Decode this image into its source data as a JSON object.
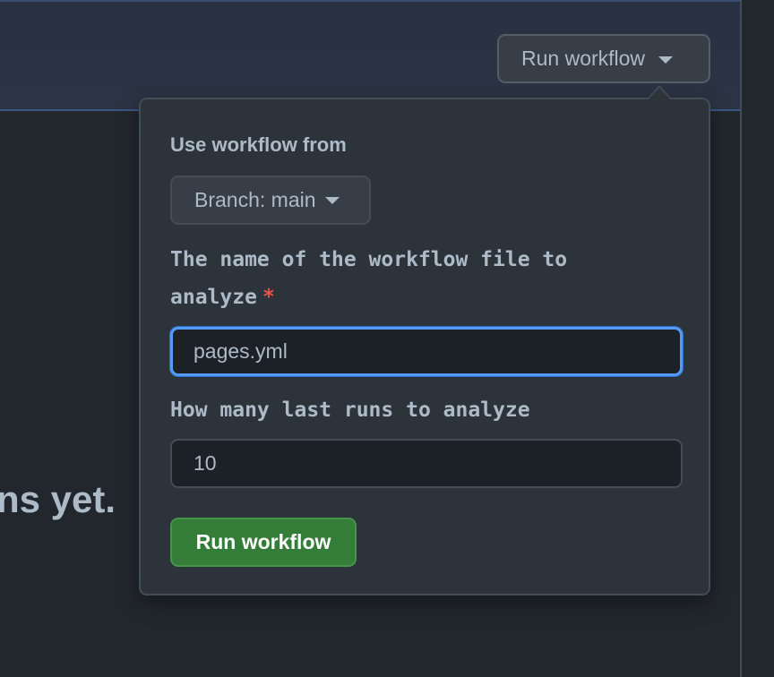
{
  "header": {
    "run_workflow_label": "Run workflow"
  },
  "main": {
    "empty_state_fragment": "ns yet."
  },
  "popover": {
    "use_workflow_from_label": "Use workflow from",
    "branch_label": "Branch: main",
    "fields": [
      {
        "label": "The name of the workflow file to analyze",
        "required": true,
        "required_marker": "*",
        "value": "pages.yml"
      },
      {
        "label": "How many last runs to analyze",
        "required": false,
        "value": "10"
      }
    ],
    "submit_label": "Run workflow"
  },
  "colors": {
    "background": "#22272e",
    "popover_bg": "#2d333b",
    "focus_border": "#539bf5",
    "primary_button": "#347d39",
    "required_star": "#e5534b",
    "text": "#adbac7"
  }
}
